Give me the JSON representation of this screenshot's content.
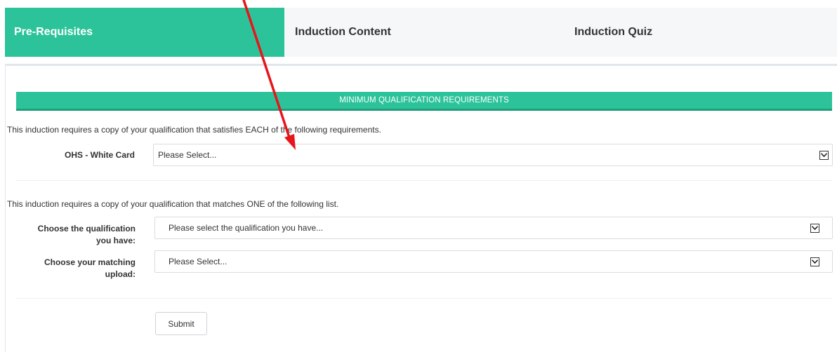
{
  "tabs": [
    {
      "label": "Pre-Requisites",
      "active": true
    },
    {
      "label": "Induction Content",
      "active": false
    },
    {
      "label": "Induction Quiz",
      "active": false
    }
  ],
  "section": {
    "title": "MINIMUM QUALIFICATION REQUIREMENTS"
  },
  "requirements_each": {
    "intro": "This induction requires a copy of your qualification that satisfies EACH of the following requirements.",
    "fields": [
      {
        "label": "OHS - White Card",
        "selected": "Please Select..."
      }
    ]
  },
  "requirements_one": {
    "intro": "This induction requires a copy of your qualification that matches ONE of the following list.",
    "qualification_label_line1": "Choose the qualification",
    "qualification_label_line2": "you have:",
    "qualification_selected": "Please select the qualification you have...",
    "upload_label_line1": "Choose your matching",
    "upload_label_line2": "upload:",
    "upload_selected": "Please Select..."
  },
  "submit_label": "Submit",
  "colors": {
    "accent": "#2cc39b",
    "annotation_arrow": "#e8141c"
  },
  "icons": {
    "dropdown": "chevron-down-icon",
    "annotation": "red-arrow-annotation"
  }
}
